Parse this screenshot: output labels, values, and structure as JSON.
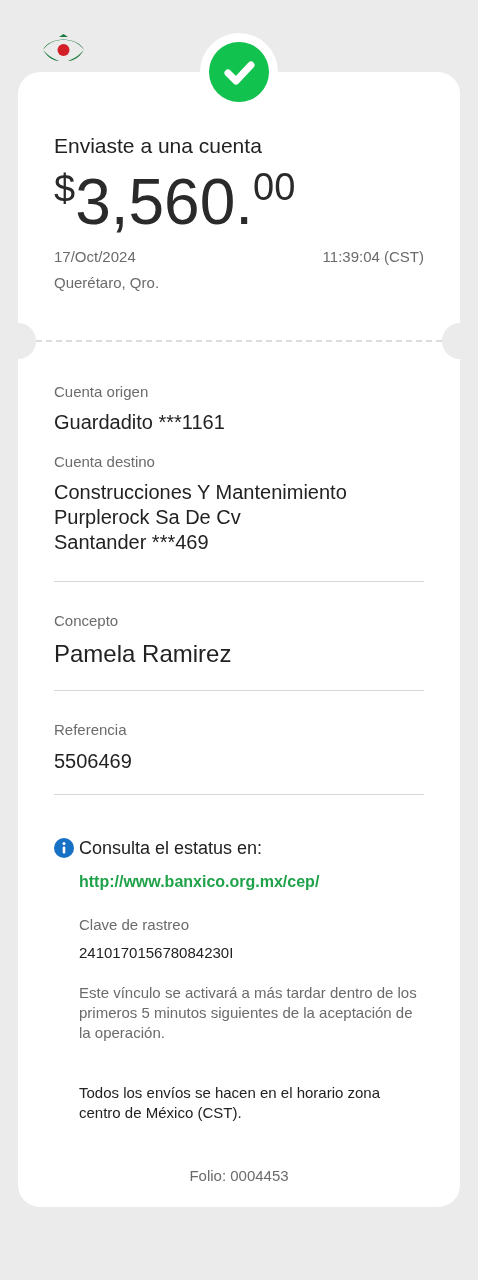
{
  "header": {
    "title": "Enviaste a una cuenta",
    "amount": {
      "currency": "$",
      "integer": "3,560.",
      "cents": "00"
    },
    "date": "17/Oct/2024",
    "time": "11:39:04 (CST)",
    "place": "Querétaro, Qro."
  },
  "origin": {
    "label": "Cuenta origen",
    "value": "Guardadito ***1161"
  },
  "destination": {
    "label": "Cuenta destino",
    "name": "Construcciones Y Mantenimiento Purplerock Sa De Cv",
    "bank": "Santander ***469"
  },
  "concept": {
    "label": "Concepto",
    "value": "Pamela Ramirez"
  },
  "reference": {
    "label": "Referencia",
    "value": "5506469"
  },
  "status": {
    "text": "Consulta el estatus en:",
    "link": "http://www.banxico.org.mx/cep/",
    "tracking_label": "Clave de rastreo",
    "tracking_value": "241017015678084230I",
    "note": "Este vínculo se activará a más tardar dentro de los primeros 5 minutos siguientes de la aceptación de la operación."
  },
  "timezone_note": "Todos los envíos se hacen en el horario zona centro de México (CST).",
  "folio": "Folio: 0004453"
}
